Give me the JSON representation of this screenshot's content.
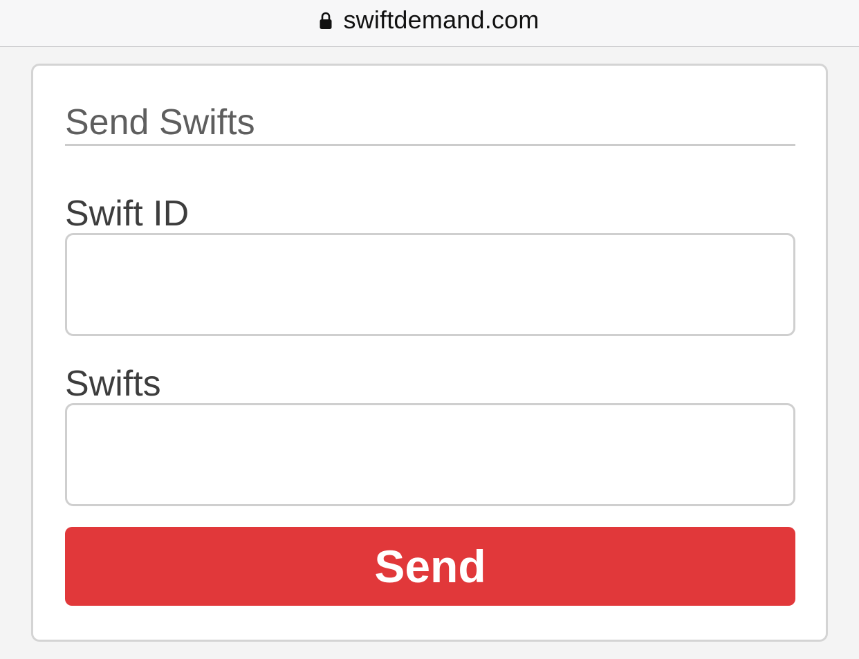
{
  "browser": {
    "url": "swiftdemand.com",
    "lock_icon": "lock-icon"
  },
  "form": {
    "title": "Send Swifts",
    "fields": [
      {
        "label": "Swift ID",
        "value": "",
        "placeholder": ""
      },
      {
        "label": "Swifts",
        "value": "",
        "placeholder": ""
      }
    ],
    "submit_label": "Send"
  },
  "colors": {
    "accent": "#e1383a",
    "border": "#d4d4d4",
    "page_background": "#f4f4f4"
  }
}
